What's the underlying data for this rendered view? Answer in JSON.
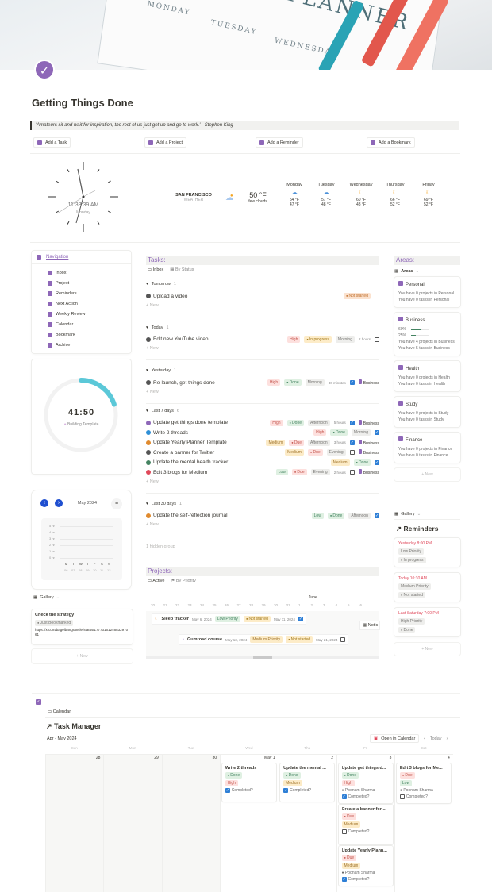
{
  "hero": {
    "words": [
      "MONDAY",
      "TUESDAY",
      "WEDNESDAY"
    ],
    "title_word": "PLANNER"
  },
  "title": "Getting Things Done",
  "quote": "'Amateurs sit and wait for inspiration, the rest of us just get up and go to work.' - Stephen King",
  "actions": [
    {
      "label": "Add a Task",
      "icon": "task-icon"
    },
    {
      "label": "Add a Project",
      "icon": "project-icon"
    },
    {
      "label": "Add a Reminder",
      "icon": "pin-icon"
    },
    {
      "label": "Add a Bookmark",
      "icon": "bookmark-icon"
    }
  ],
  "clock": {
    "time": "11:33:39 AM",
    "day": "Monday"
  },
  "weather": {
    "city": "SAN FRANCISCO",
    "label": "WEATHER",
    "temp": "50 °F",
    "desc": "few clouds",
    "days": [
      {
        "day": "Monday",
        "icon": "cloud-icon",
        "hi": "54 °F",
        "lo": "47 °F"
      },
      {
        "day": "Tuesday",
        "icon": "cloud-icon",
        "hi": "57 °F",
        "lo": "48 °F"
      },
      {
        "day": "Wednesday",
        "icon": "moon-icon",
        "hi": "60 °F",
        "lo": "48 °F"
      },
      {
        "day": "Thursday",
        "icon": "moon-icon",
        "hi": "66 °F",
        "lo": "52 °F"
      },
      {
        "day": "Friday",
        "icon": "moon-icon",
        "hi": "69 °F",
        "lo": "52 °F"
      }
    ]
  },
  "navigation": {
    "title": "Navigation",
    "items": [
      "Inbox",
      "Project",
      "Reminders",
      "Next Action",
      "Weekly Review",
      "Calendar",
      "Bookmark",
      "Archive"
    ]
  },
  "timer": {
    "time": "41:50",
    "label": "Building Template",
    "progress": 0.2
  },
  "mini_calendar": {
    "month": "May 2024",
    "ylabels": [
      "5 hr",
      "4 hr",
      "3 hr",
      "2 hr",
      "1 hr",
      "0 hr"
    ],
    "days": [
      "M",
      "T",
      "W",
      "T",
      "F",
      "S",
      "S"
    ],
    "dates": [
      "06",
      "07",
      "08",
      "09",
      "10",
      "11",
      "12"
    ]
  },
  "gallery": {
    "view": "Gallery",
    "bookmark": {
      "title": "Check the strategy",
      "status": "Just Bookmarked",
      "url": "https://x.com/bagelbangrancle/status/1777316124683297061"
    },
    "new": "+ New"
  },
  "tasks": {
    "title": "Tasks:",
    "tabs": [
      "Inbox",
      "By Status"
    ],
    "new": "+ New",
    "hidden": "1 hidden group",
    "groups": [
      {
        "name": "Tomorrow",
        "count": "1",
        "items": [
          {
            "name": "Upload a video",
            "color": "#555",
            "tags": [
              [
                "Not started",
                "NS",
                1
              ]
            ],
            "dur": "",
            "cb": false,
            "area": ""
          }
        ]
      },
      {
        "name": "Today",
        "count": "1",
        "items": [
          {
            "name": "Edit new YouTube video",
            "color": "#555",
            "tags": [
              [
                "High",
                "High",
                0
              ],
              [
                "In progress",
                "IP",
                1
              ],
              [
                "Morning",
                "Gray",
                0
              ]
            ],
            "dur": "2 hours",
            "cb": false,
            "area": ""
          }
        ]
      },
      {
        "name": "Yesterday",
        "count": "1",
        "items": [
          {
            "name": "Re-launch, get things done",
            "color": "#555",
            "tags": [
              [
                "High",
                "High",
                0
              ],
              [
                "Done",
                "Done",
                1
              ],
              [
                "Morning",
                "Gray",
                0
              ]
            ],
            "dur": "30 minutes",
            "cb": true,
            "area": "Business"
          }
        ]
      },
      {
        "name": "Last 7 days",
        "count": "6",
        "items": [
          {
            "name": "Update get things done template",
            "color": "#8e67b8",
            "tags": [
              [
                "High",
                "High",
                0
              ],
              [
                "Done",
                "Done",
                1
              ],
              [
                "Afternoon",
                "Gray",
                0
              ]
            ],
            "dur": "5 hours",
            "cb": true,
            "area": "Business"
          },
          {
            "name": "Write 2 threads",
            "color": "#2e8fd6",
            "tags": [
              [
                "High",
                "High",
                0
              ],
              [
                "Done",
                "Done",
                1
              ],
              [
                "Morning",
                "Gray",
                0
              ]
            ],
            "dur": "",
            "cb": true,
            "area": ""
          },
          {
            "name": "Update Yearly Planner Template",
            "color": "#e08a2d",
            "tags": [
              [
                "Medium",
                "Medium",
                0
              ],
              [
                "Due",
                "Due",
                1
              ],
              [
                "Afternoon",
                "Gray",
                0
              ]
            ],
            "dur": "3 hours",
            "cb": true,
            "area": "Business"
          },
          {
            "name": "Create a banner for Twitter",
            "color": "#555",
            "tags": [
              [
                "Medium",
                "Medium",
                0
              ],
              [
                "Due",
                "Due",
                1
              ],
              [
                "Evening",
                "Gray",
                0
              ]
            ],
            "dur": "",
            "cb": false,
            "area": "Business"
          },
          {
            "name": "Update the mental health tracker",
            "color": "#448361",
            "tags": [
              [
                "Medium",
                "Medium",
                0
              ],
              [
                "Done",
                "Done",
                1
              ]
            ],
            "dur": "",
            "cb": true,
            "area": ""
          },
          {
            "name": "Edit 3 blogs for Medium",
            "color": "#e0485a",
            "tags": [
              [
                "Low",
                "Low",
                0
              ],
              [
                "Due",
                "Due",
                1
              ],
              [
                "Evening",
                "Gray",
                0
              ]
            ],
            "dur": "2 hours",
            "cb": false,
            "area": "Business"
          }
        ]
      },
      {
        "name": "Last 30 days",
        "count": "1",
        "items": [
          {
            "name": "Update the self-reflection journal",
            "color": "#e08a2d",
            "tags": [
              [
                "Low",
                "Low",
                0
              ],
              [
                "Done",
                "Done",
                1
              ],
              [
                "Afternoon",
                "Gray",
                0
              ]
            ],
            "dur": "",
            "cb": true,
            "area": ""
          }
        ]
      }
    ]
  },
  "projects": {
    "title": "Projects:",
    "tabs": [
      "Active",
      "By Priority"
    ],
    "month": "June",
    "dates": [
      "20",
      "21",
      "22",
      "23",
      "24",
      "25",
      "26",
      "27",
      "28",
      "29",
      "30",
      "31",
      "1",
      "2",
      "3",
      "4",
      "5",
      "6"
    ],
    "items": [
      {
        "name": "Sleep tracker",
        "start": "May 6, 2024",
        "priority": "Low Priority",
        "status": "Not started",
        "end": "May 11, 2024",
        "cb": true
      },
      {
        "name": "Gumroad course",
        "start": "May 13, 2024",
        "priority": "Medium Priority",
        "status": "Not started",
        "end": "May 21, 2024",
        "cb": false
      }
    ],
    "partial": "Notic"
  },
  "areas": {
    "title": "Areas:",
    "view": "Areas",
    "new": "+ New",
    "items": [
      {
        "name": "Personal",
        "lines": [
          "You have 0 projects in Personal",
          "You have 0 tasks in Personal"
        ],
        "bars": []
      },
      {
        "name": "Business",
        "lines": [
          "You have 4 projects in Business",
          "You have 5 tasks in Business"
        ],
        "bars": [
          {
            "label": "60%",
            "value": 0.6
          },
          {
            "label": "25%",
            "value": 0.25
          }
        ]
      },
      {
        "name": "Health",
        "lines": [
          "You have 0 projects in Health",
          "You have 0 tasks in Health"
        ],
        "bars": []
      },
      {
        "name": "Study",
        "lines": [
          "You have 0 projects in Study",
          "You have 0 tasks in Study"
        ],
        "bars": []
      },
      {
        "name": "Finance",
        "lines": [
          "You have 0 projects in Finance",
          "You have 0 tasks in Finance"
        ],
        "bars": []
      }
    ]
  },
  "reminders": {
    "view": "Gallery",
    "title": "Reminders",
    "new": "+ New",
    "items": [
      {
        "date": "Yesterday 8:00 PM",
        "priority": "Low Priority",
        "status": "In progress"
      },
      {
        "date": "Today 10:30 AM",
        "priority": "Medium Priority",
        "status": "Not started"
      },
      {
        "date": "Last Saturday 7:00 PM",
        "priority": "High Priority",
        "status": "Done"
      }
    ]
  },
  "task_manager": {
    "view": "Calendar",
    "title": "Task Manager",
    "range": "Apr - May 2024",
    "open": "Open in Calendar",
    "today": "Today",
    "weekdays": [
      "Sun",
      "Mon",
      "Tue",
      "Wed",
      "Thu",
      "Fri",
      "Sat"
    ],
    "dates": [
      "28",
      "29",
      "30",
      "May 1",
      "2",
      "3",
      "4"
    ],
    "completed": "Completed?",
    "person": "Poonam Sharma",
    "cards": [
      {
        "col": 3,
        "slot": 0,
        "title": "Write 2 threads",
        "status": "Done",
        "priority": "High",
        "person": false,
        "cb": true
      },
      {
        "col": 4,
        "slot": 0,
        "title": "Update the mental ...",
        "status": "Done",
        "priority": "Medium",
        "person": false,
        "cb": true
      },
      {
        "col": 5,
        "slot": 0,
        "title": "Update get things d...",
        "status": "Done",
        "priority": "High",
        "person": true,
        "cb": true
      },
      {
        "col": 5,
        "slot": 1,
        "title": "Create a banner for ...",
        "status": "Due",
        "priority": "Medium",
        "person": false,
        "cb": false
      },
      {
        "col": 5,
        "slot": 2,
        "title": "Update Yearly Plann...",
        "status": "Due",
        "priority": "Medium",
        "person": true,
        "cb": true
      },
      {
        "col": 6,
        "slot": 0,
        "title": "Edit 3 blogs for Me...",
        "status": "Due",
        "priority": "Low",
        "person": true,
        "cb": false
      }
    ]
  },
  "colors": {
    "accent": "#8e67b8",
    "timer": "#5bc8d8",
    "link_red": "#e0485a",
    "check_blue": "#2e7fd6"
  }
}
